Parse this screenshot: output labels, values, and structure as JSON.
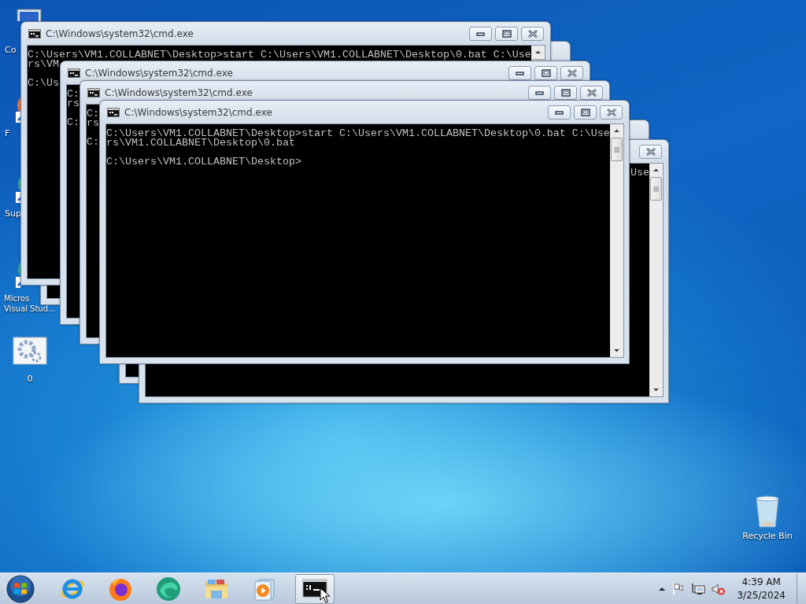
{
  "desktop_icons": [
    {
      "kind": "computer",
      "label_lines": [
        "Co"
      ]
    },
    {
      "kind": "browser",
      "label_lines": [
        "F"
      ]
    },
    {
      "kind": "shortcut",
      "label_lines": [
        "Sup"
      ]
    },
    {
      "kind": "shortcut",
      "label_lines": [
        "Micros",
        "Visual Stud..."
      ]
    },
    {
      "kind": "gear",
      "label_lines": [
        "0"
      ]
    },
    {
      "kind": "recycle",
      "label_lines": [
        "Recycle Bin"
      ]
    }
  ],
  "windows": [
    {
      "kind": "console"
    },
    {
      "kind": "console",
      "title": "C:\\Windows\\system32\\cmd.exe",
      "blocks": [
        [
          "C:\\Users\\VM1.COLLABNET\\Desktop>start C:\\Users\\VM1.COLLABNET\\Desktop\\0.bat C:\\Use",
          "rs\\VM"
        ],
        [
          "C:\\Us"
        ]
      ]
    },
    {
      "kind": "console",
      "title": "C:\\Windows\\system32\\cmd.exe",
      "blocks": [
        [
          "C:",
          "rs"
        ],
        [
          "C:"
        ]
      ]
    },
    {
      "kind": "console",
      "title": "C:\\Windows\\system32\\cmd.exe",
      "blocks": [
        [
          "C:",
          "rs"
        ],
        [
          "C:"
        ]
      ]
    },
    {
      "kind": "console"
    },
    {
      "kind": "console",
      "blocks": [
        [
          "Use"
        ]
      ]
    },
    {
      "kind": "console",
      "title": "C:\\Windows\\system32\\cmd.exe",
      "blocks": [
        [
          "C:\\Users\\VM1.COLLABNET\\Desktop>start C:\\Users\\VM1.COLLABNET\\Desktop\\0.bat C:\\Use",
          "rs\\VM1.COLLABNET\\Desktop\\0.bat"
        ],
        [
          "C:\\Users\\VM1.COLLABNET\\Desktop>"
        ]
      ]
    }
  ],
  "taskbar": {
    "items": [
      {
        "kind": "ie",
        "selected": false
      },
      {
        "kind": "firefox",
        "selected": false
      },
      {
        "kind": "edge",
        "selected": false
      },
      {
        "kind": "folder",
        "selected": false
      },
      {
        "kind": "media",
        "selected": false
      },
      {
        "kind": "console",
        "selected": true
      }
    ],
    "time": "4:39 AM",
    "date": "3/25/2024"
  }
}
